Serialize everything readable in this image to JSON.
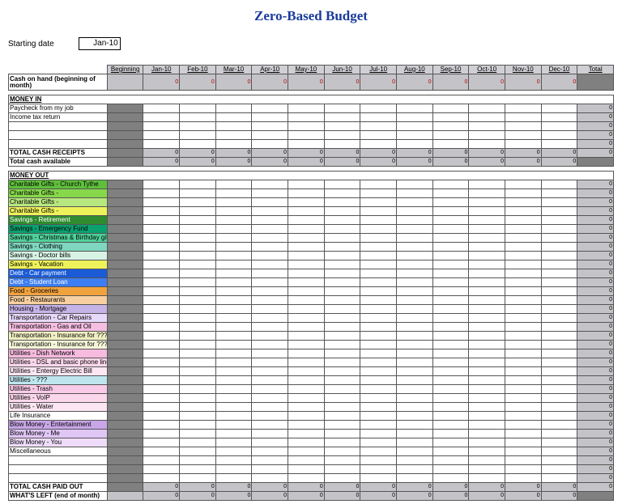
{
  "title": "Zero-Based Budget",
  "starting": {
    "label": "Starting date",
    "value": "Jan-10"
  },
  "columns": [
    "Beginning",
    "Jan-10",
    "Feb-10",
    "Mar-10",
    "Apr-10",
    "May-10",
    "Jun-10",
    "Jul-10",
    "Aug-10",
    "Sep-10",
    "Oct-10",
    "Nov-10",
    "Dec-10",
    "Total"
  ],
  "zero": "0",
  "rows": {
    "cash_on_hand": "Cash on hand (beginning of month)",
    "money_in": "MONEY IN",
    "paycheck": "Paycheck from my job",
    "itr": "Income tax return",
    "total_receipts": "TOTAL CASH RECEIPTS",
    "total_avail": "Total cash available",
    "money_out": "MONEY OUT",
    "paid_out": "TOTAL CASH PAID OUT",
    "whats_left": "WHAT'S LEFT (end of month)"
  },
  "cats": [
    {
      "label": "Charitable Gifts - Church Tythe",
      "c": "c-green1"
    },
    {
      "label": "Charitable Gifts -",
      "c": "c-green2"
    },
    {
      "label": "Charitable Gifts -",
      "c": "c-green3"
    },
    {
      "label": "Charitable Gifts -",
      "c": "c-yellow"
    },
    {
      "label": "Savings - Retirement",
      "c": "c-darkgreen"
    },
    {
      "label": "Savings - Emergency Fund",
      "c": "c-teal"
    },
    {
      "label": "Savings - Christmas & Birthday gifts",
      "c": "c-mint"
    },
    {
      "label": "Savings - Clothing",
      "c": "c-teal2"
    },
    {
      "label": "Savings - Doctor bills",
      "c": "c-pale"
    },
    {
      "label": "Savings - Vacation",
      "c": "c-yellow"
    },
    {
      "label": "Debt - Car payment",
      "c": "c-blue1"
    },
    {
      "label": "Debt - Student Loan",
      "c": "c-blue2"
    },
    {
      "label": "Food - Groceries",
      "c": "c-orange"
    },
    {
      "label": "Food - Restaurants",
      "c": "c-peach"
    },
    {
      "label": "Housing - Mortgage",
      "c": "c-lav1"
    },
    {
      "label": "Transportation - Car Repairs",
      "c": "c-lav2"
    },
    {
      "label": "Transportation - Gas and Oil",
      "c": "c-pink"
    },
    {
      "label": "Transportation - Insurance for ???",
      "c": "c-ly1"
    },
    {
      "label": "Transportation - Insurance for ???",
      "c": "c-ly2"
    },
    {
      "label": "Utilities - Dish Network",
      "c": "c-pink1"
    },
    {
      "label": "Utilities - DSL and basic phone line",
      "c": "c-pink2"
    },
    {
      "label": "Utilities - Entergy Electric Bill",
      "c": "c-pink3"
    },
    {
      "label": "Utilities - ???",
      "c": "c-cyan"
    },
    {
      "label": "Utilities - Trash",
      "c": "c-pink4"
    },
    {
      "label": "Utilities - VoIP",
      "c": "c-pink2"
    },
    {
      "label": "Utilities - Water",
      "c": "c-pink3"
    },
    {
      "label": "Life Insurance",
      "c": ""
    },
    {
      "label": "Blow Money - Entertainment",
      "c": "c-purp1"
    },
    {
      "label": "Blow Money - Me",
      "c": "c-purp2"
    },
    {
      "label": "Blow Money - You",
      "c": "c-purp3"
    },
    {
      "label": "Miscellaneous",
      "c": ""
    }
  ]
}
